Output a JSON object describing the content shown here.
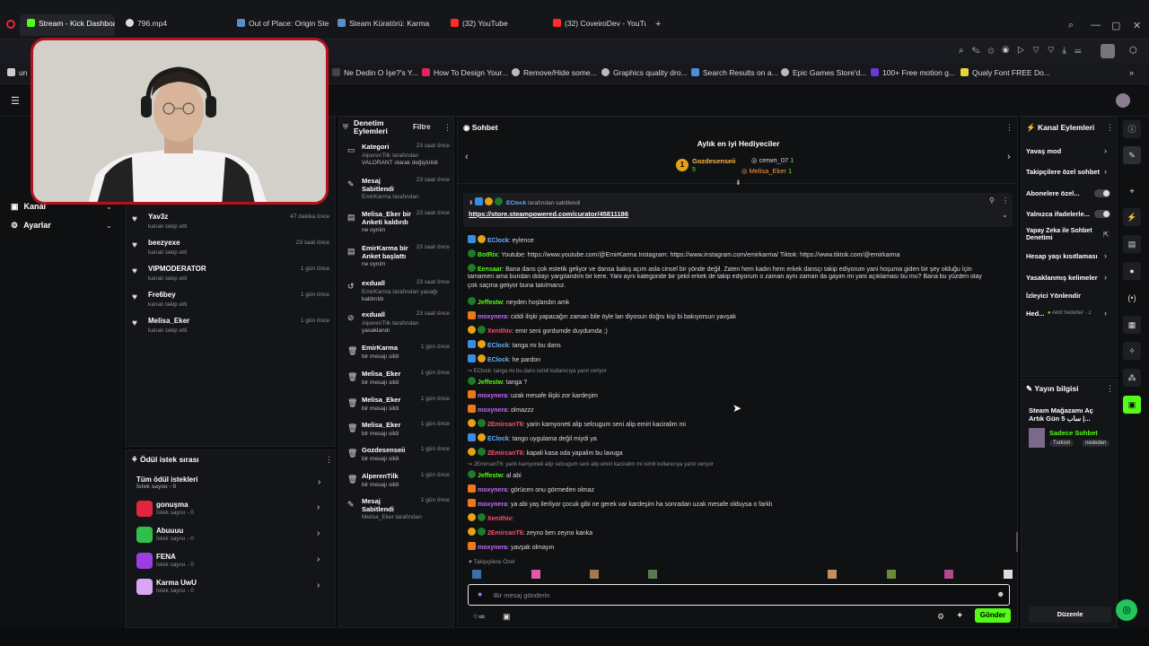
{
  "browser": {
    "tabs": [
      "Stream - Kick Dashboard",
      "796.mp4",
      "Out of Place: Origin Steam",
      "Steam Küratörü: Karma St",
      "(32) YouTube",
      "(32) CoveiroDev - YouTub"
    ],
    "new_tab": "+"
  },
  "bookmarks": [
    "un",
    "Ne Dedin O İşe?'s Y...",
    "How To Design Your...",
    "Remove/Hide some...",
    "Graphics quality dro...",
    "Search Results on a...",
    "Epic Games Store'd...",
    "100+ Free motion g...",
    "Qualy Font FREE Do..."
  ],
  "sidebar": {
    "items": [
      "Kanal",
      "Ayarlar"
    ]
  },
  "follows": [
    {
      "name": "Yav3z",
      "action": "kanalı takip etti",
      "time": "47 dakika önce"
    },
    {
      "name": "beezyexe",
      "action": "kanalı takip etti",
      "time": "23 saat önce"
    },
    {
      "name": "VIPMODERATOR",
      "action": "kanalı takip etti",
      "time": "1 gün önce"
    },
    {
      "name": "Fre6bey",
      "action": "kanalı takip etti",
      "time": "1 gün önce"
    },
    {
      "name": "Melisa_Eker",
      "action": "kanalı takip etti",
      "time": "1 gün önce"
    }
  ],
  "rewards": {
    "title": "Ödül istek sırası",
    "all_label": "Tüm ödül istekleri",
    "all_count": "İstek sayısı - 0",
    "items": [
      {
        "name": "gonuşma",
        "count": "İstek sayısı - 0",
        "color": "#e0263f"
      },
      {
        "name": "Abuuuu",
        "count": "İstek sayısı - 0",
        "color": "#2fbf4a"
      },
      {
        "name": "FENA",
        "count": "İstek sayısı - 0",
        "color": "#9b3fe0"
      },
      {
        "name": "Karma UwU",
        "count": "İstek sayısı - 0",
        "color": "#d9a6f5"
      }
    ]
  },
  "mod": {
    "title": "Denetim Eylemleri",
    "filter": "Filtre",
    "items": [
      {
        "title": "Kategori",
        "time": "23 saat önce",
        "line1": "AlperenTilk tarafından",
        "line2": "VALORANT olarak değiştirildi",
        "icon": "▭"
      },
      {
        "title": "Mesaj Sabitlendi",
        "time": "23 saat önce",
        "line1": "EmirKarma tarafından",
        "line2": "",
        "icon": "✎"
      },
      {
        "title": "Melisa_Eker bir Anketi kaldırdı",
        "time": "23 saat önce",
        "line1": "ne oynim",
        "line2": "",
        "icon": "▤"
      },
      {
        "title": "EmirKarma bir Anket başlattı",
        "time": "23 saat önce",
        "line1": "ne oynim",
        "line2": "",
        "icon": "▤"
      },
      {
        "title": "exduall",
        "time": "23 saat önce",
        "line1": "EmirKarma tarafından yasağı",
        "line2": "kaldırıldı",
        "icon": "↺"
      },
      {
        "title": "exduall",
        "time": "23 saat önce",
        "line1": "AlperenTilk tarafından",
        "line2": "yasaklandı",
        "icon": "⊘"
      },
      {
        "title": "EmirKarma",
        "time": "1 gün önce",
        "line1": "bir mesajı sildi",
        "line2": "",
        "icon": "🗑"
      },
      {
        "title": "Melisa_Eker",
        "time": "1 gün önce",
        "line1": "bir mesajı sildi",
        "line2": "",
        "icon": "🗑"
      },
      {
        "title": "Melisa_Eker",
        "time": "1 gün önce",
        "line1": "bir mesajı sildi",
        "line2": "",
        "icon": "🗑"
      },
      {
        "title": "Melisa_Eker",
        "time": "1 gün önce",
        "line1": "bir mesajı sildi",
        "line2": "",
        "icon": "🗑"
      },
      {
        "title": "Gozdesenseii",
        "time": "1 gün önce",
        "line1": "bir mesajı sildi",
        "line2": "",
        "icon": "🗑"
      },
      {
        "title": "AlperenTilk",
        "time": "1 gün önce",
        "line1": "bir mesajı sildi",
        "line2": "",
        "icon": "🗑"
      },
      {
        "title": "Mesaj Sabitlendi",
        "time": "1 gün önce",
        "line1": "Melisa_Eker tarafından",
        "line2": "",
        "icon": "✎"
      }
    ]
  },
  "chat": {
    "title": "Sohbet",
    "gifters_title": "Aylık en iyi Hediyeciler",
    "gifters": [
      {
        "name": "Gozdesenseii",
        "count": "5"
      },
      {
        "name": "cerwn_07",
        "count": "1"
      },
      {
        "name": "Melisa_Eker",
        "count": "1"
      }
    ],
    "pinned_by": "EClock",
    "pinned_suffix": "tarafından sabitlendi",
    "pinned_link": "https://store.steampowered.com/curator/45811186",
    "messages": [
      {
        "user": "EClock",
        "cls": "u-b",
        "text": "eylence"
      },
      {
        "user": "BotRix",
        "cls": "u-g",
        "text": "Youtube: https://www.youtube.com/@EmirKarma Instagram: https://www.instagram.com/emirkarma/ Tiktok: https://www.tiktok.com/@emirkarma"
      },
      {
        "user": "Eensaar",
        "cls": "u-g",
        "text": "Bana dans çok estetik geliyor ve dansa bakış açım asla cinsel bir yönde değil. Zaten hem kadın hem erkek dansçı takip ediyorum yani hoşuma giden bir şey olduğu İçin"
      },
      {
        "user": "",
        "cls": "",
        "text": "tamamen ama bundan dolayı yargılandım bir kere. Yani aynı kategoride bir şekil erkek de takip ediyorum o zaman aynı zaman da gayim mi yani açıklaması bu mu? Bana bu yüzden olay"
      },
      {
        "user": "",
        "cls": "",
        "text": "çok saçma geliyor buna takılmanız."
      },
      {
        "user": "Jeffestw",
        "cls": "u-g",
        "text": "neyden hoşlandın amk"
      },
      {
        "user": "moxynera",
        "cls": "u-p",
        "text": "ciddi ilişki yapacağın zaman bile öyle lan diyosun doğru kişi bi bakıyorsun yavşak"
      },
      {
        "user": "Xenithiv",
        "cls": "u-r",
        "text": "emir seni gordumde duydumda ;)"
      },
      {
        "user": "EClock",
        "cls": "u-b",
        "text": "tanga mı bu dans"
      },
      {
        "user": "EClock",
        "cls": "u-b",
        "text": "he pardon"
      },
      {
        "user": "",
        "cls": "muted",
        "text": "↪ EClock: tanga mı bu dans isimli kullanıcıya yanıt veriyor"
      },
      {
        "user": "Jeffestw",
        "cls": "u-g",
        "text": "tanga ?"
      },
      {
        "user": "moxynera",
        "cls": "u-p",
        "text": "uzak mesafe ilişki zor kardeşim"
      },
      {
        "user": "moxynera",
        "cls": "u-p",
        "text": "olmazzz"
      },
      {
        "user": "2EmircanT6",
        "cls": "u-r",
        "text": "yarin kamyoneti alip selcugum seni alip emiri kaciralim mi"
      },
      {
        "user": "EClock",
        "cls": "u-b",
        "text": "tango uygulama değil miydi ya"
      },
      {
        "user": "2EmircanT6",
        "cls": "u-r",
        "text": "kapali kasa oda yapalim bu lavuga"
      },
      {
        "user": "",
        "cls": "muted",
        "text": "↪ 2EmircanT6: yarin kamyoneti alip selcugum seni alip emiri kaciralim mi isimli kullanıcıya yanıt veriyor"
      },
      {
        "user": "Jeffestw",
        "cls": "u-g",
        "text": "al abi"
      },
      {
        "user": "moxynera",
        "cls": "u-p",
        "text": "görücen onu görmeden olmaz"
      },
      {
        "user": "moxynera",
        "cls": "u-p",
        "text": "ya abi yaş ilerliyor çocuk gibi ne gerek var kardeşim ha sonradan uzak mesafe olduysa o farklı"
      },
      {
        "user": "Xenithiv",
        "cls": "u-r",
        "text": ""
      },
      {
        "user": "2EmircanT6",
        "cls": "u-r",
        "text": "zeyno ben zeyno kanka"
      },
      {
        "user": "moxynera",
        "cls": "u-p",
        "text": "yavşak olmayın"
      }
    ],
    "followers_only": "Takipçilere Özel",
    "input_placeholder": "Bir mesaj gönderin",
    "send": "Gönder"
  },
  "channel_actions": {
    "title": "Kanal Eylemleri",
    "items": [
      "Yavaş mod",
      "Takipçilere özel sohbet",
      "Abonelere özel...",
      "Yalnızca ifadelerle...",
      "Yapay Zeka ile Sohbet Denetimi",
      "Hesap yaşı kısıtlaması",
      "Yasaklanmış kelimeler",
      "İzleyici Yönlendir",
      "Hed...",
      "Aktif hedefler - 2"
    ]
  },
  "stream_info": {
    "title": "Yayın bilgisi",
    "stream_title": "Steam Mağazamı Aç Artık Gün 5 ساب |...",
    "mode": "Sadece Sohbet",
    "tags": [
      "Turkish",
      "nededen"
    ],
    "edit": "Düzenle"
  },
  "colors": {
    "accent": "#53fc18",
    "webcam_border": "#b3121f"
  }
}
